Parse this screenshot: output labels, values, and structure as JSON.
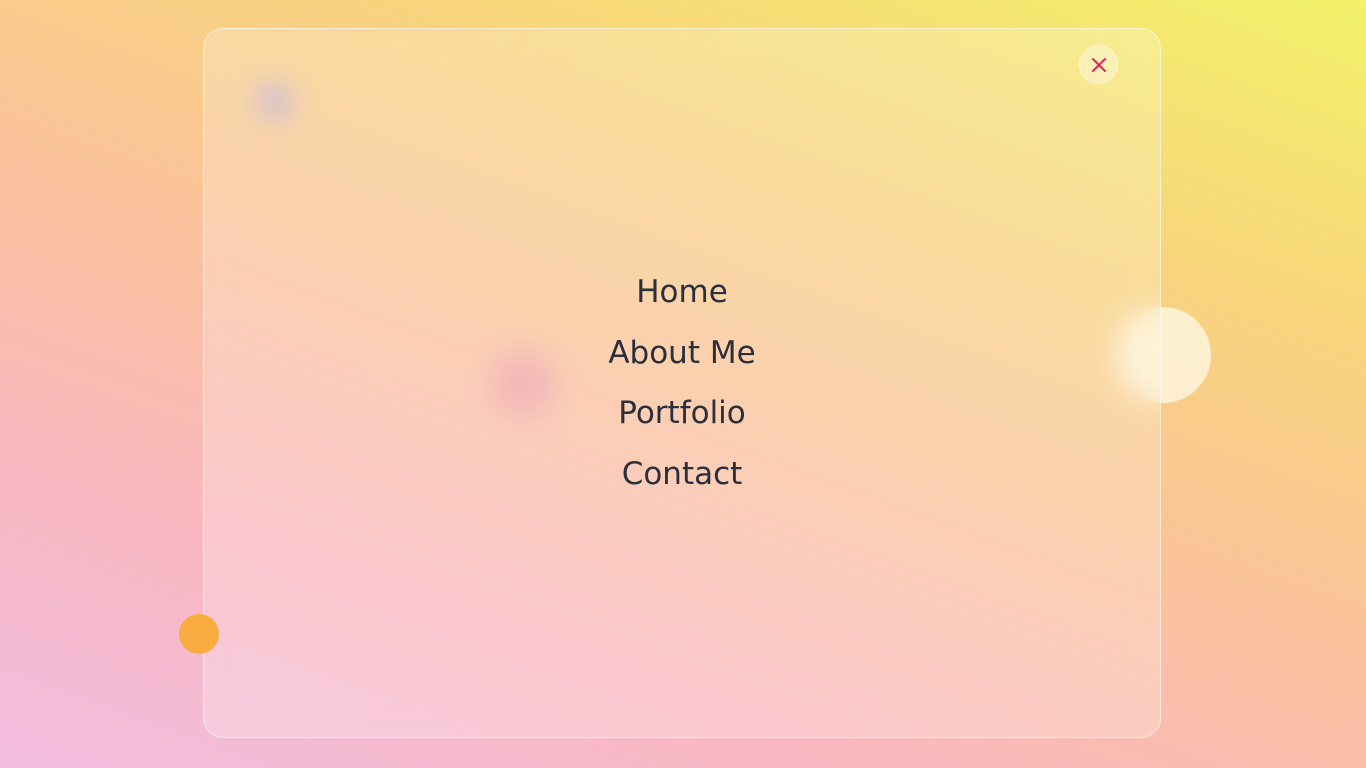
{
  "menu": {
    "items": [
      {
        "label": "Home"
      },
      {
        "label": "About Me"
      },
      {
        "label": "Portfolio"
      },
      {
        "label": "Contact"
      }
    ]
  },
  "close_button": {
    "icon": "close-icon",
    "color": "#e0245e"
  },
  "colors": {
    "text": "#2b2e3b",
    "accent_close": "#e0245e",
    "gradient": [
      "#f2bde0",
      "#f9b8c0",
      "#fac39a",
      "#f8d67a",
      "#f3f26a"
    ]
  }
}
